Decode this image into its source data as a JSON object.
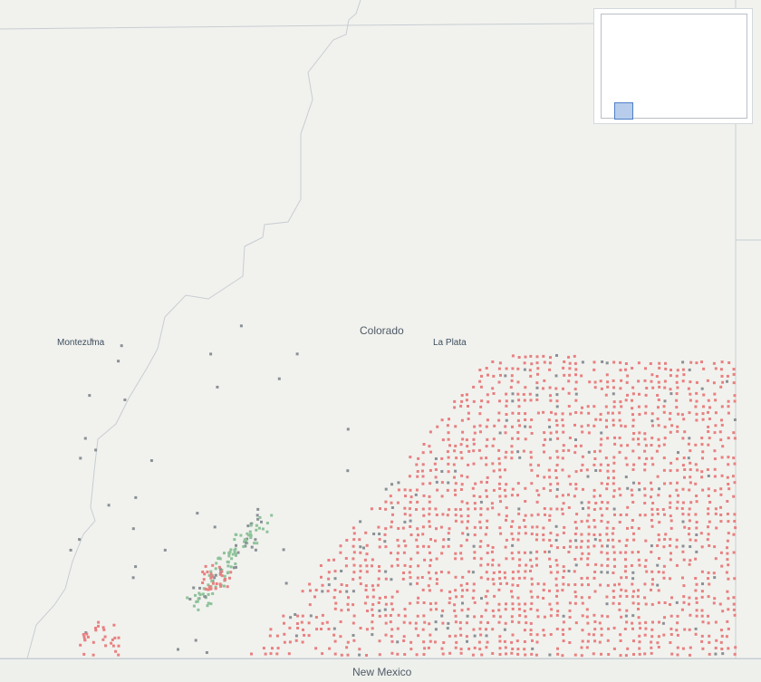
{
  "labels": {
    "state_colorado": "Colorado",
    "state_new_mexico": "New Mexico",
    "county_montezuma": "Montezuma",
    "county_la_plata": "La Plata"
  },
  "colors": {
    "land": "#f1f2ee",
    "boundary": "#c8cdd2",
    "well_red": "#e88080",
    "well_green": "#8ec29a",
    "well_gray": "#8a9096",
    "overview_view_fill": "#b8cdeb",
    "overview_view_stroke": "#4e7fc9"
  },
  "legend_semantics": {
    "markers": "well-square-marker"
  },
  "overview_map": {
    "icon": "overview-minimap"
  }
}
